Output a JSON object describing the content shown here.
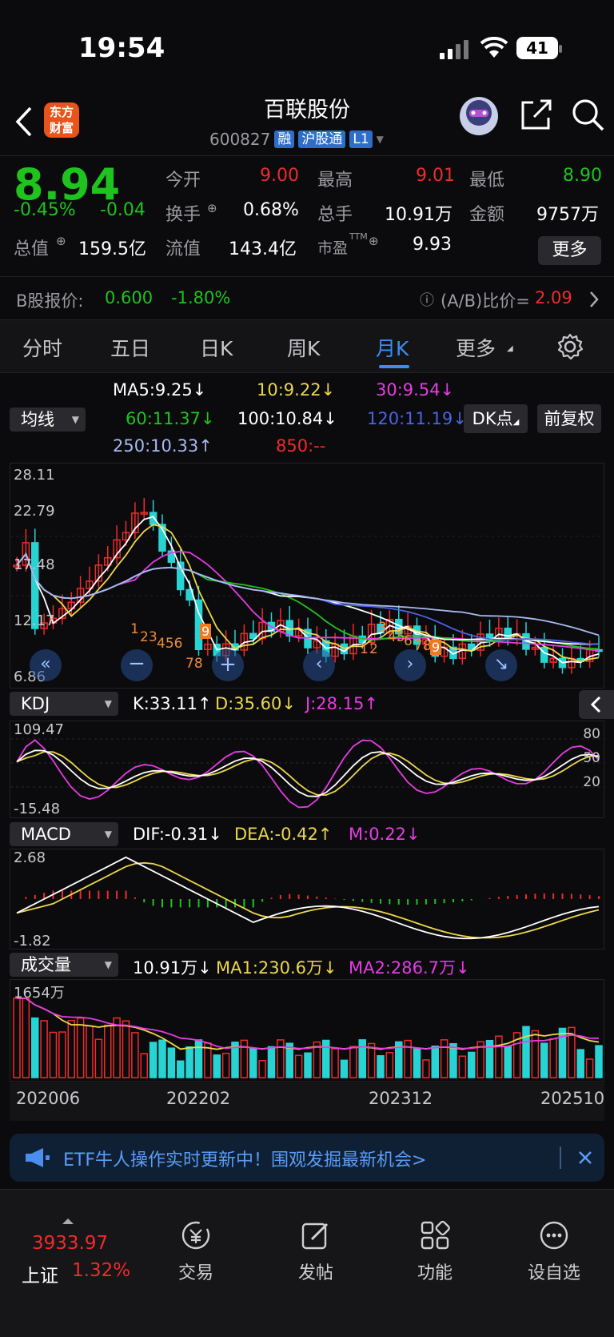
{
  "status": {
    "time": "19:54",
    "battery": "41"
  },
  "header": {
    "logo_line1": "东方",
    "logo_line2": "财富",
    "name": "百联股份",
    "code": "600827",
    "tags": [
      "融",
      "沪股通",
      "L1"
    ]
  },
  "quote": {
    "price": "8.94",
    "pct": "-0.45%",
    "chg": "-0.04",
    "open_label": "今开",
    "open": "9.00",
    "high_label": "最高",
    "high": "9.01",
    "low_label": "最低",
    "low": "8.90",
    "turnover_label": "换手",
    "turnover": "0.68%",
    "vol_label": "总手",
    "vol": "10.91万",
    "amount_label": "金额",
    "amount": "9757万",
    "mktcap_label": "总值",
    "mktcap": "159.5亿",
    "float_label": "流值",
    "float": "143.4亿",
    "pe_label": "市盈",
    "pe_sup": "TTM",
    "pe": "9.93",
    "more": "更多"
  },
  "bshare": {
    "label": "B股报价:",
    "price": "0.600",
    "pct": "-1.80%",
    "ratio_label": "(A/B)比价=",
    "ratio": "2.09"
  },
  "tabs": [
    "分时",
    "五日",
    "日K",
    "周K",
    "月K",
    "更多"
  ],
  "ma": {
    "selector": "均线",
    "ma5": "MA5:9.25↓",
    "ma10": "10:9.22↓",
    "ma30": "30:9.54↓",
    "ma60": "60:11.37↓",
    "ma100": "100:10.84↓",
    "ma120": "120:11.19↓",
    "ma250": "250:10.33↑",
    "ma850": "850:--",
    "dk": "DK点",
    "adjust": "前复权"
  },
  "kline": {
    "ticks": [
      "28.11",
      "22.79",
      "17.48",
      "12.17",
      "6.86"
    ],
    "marks": [
      "1",
      "23",
      "456",
      "78",
      "9",
      "3",
      "45",
      "6",
      "78",
      "9",
      "1",
      "2"
    ]
  },
  "kdj": {
    "selector": "KDJ",
    "k": "K:33.11↑",
    "d": "D:35.60↓",
    "j": "J:28.15↑",
    "top": "109.47",
    "bottom": "-15.48",
    "levels": [
      "80",
      "50",
      "20"
    ]
  },
  "macd": {
    "selector": "MACD",
    "dif": "DIF:-0.31↓",
    "dea": "DEA:-0.42↑",
    "m": "M:0.22↓",
    "top": "2.68",
    "bottom": "-1.82"
  },
  "volume": {
    "selector": "成交量",
    "vol": "10.91万↓",
    "ma1": "MA1:230.6万↓",
    "ma2": "MA2:286.7万↓",
    "top": "1654万"
  },
  "dates": [
    "202006",
    "202202",
    "202312",
    "202510"
  ],
  "banner": {
    "text": "ETF牛人操作实时更新中！围观发掘最新机会>"
  },
  "bottom": {
    "index_value": "3933.97",
    "index_name": "上证",
    "index_pct": "1.32%",
    "nav": [
      "交易",
      "发帖",
      "功能",
      "设自选"
    ]
  }
}
